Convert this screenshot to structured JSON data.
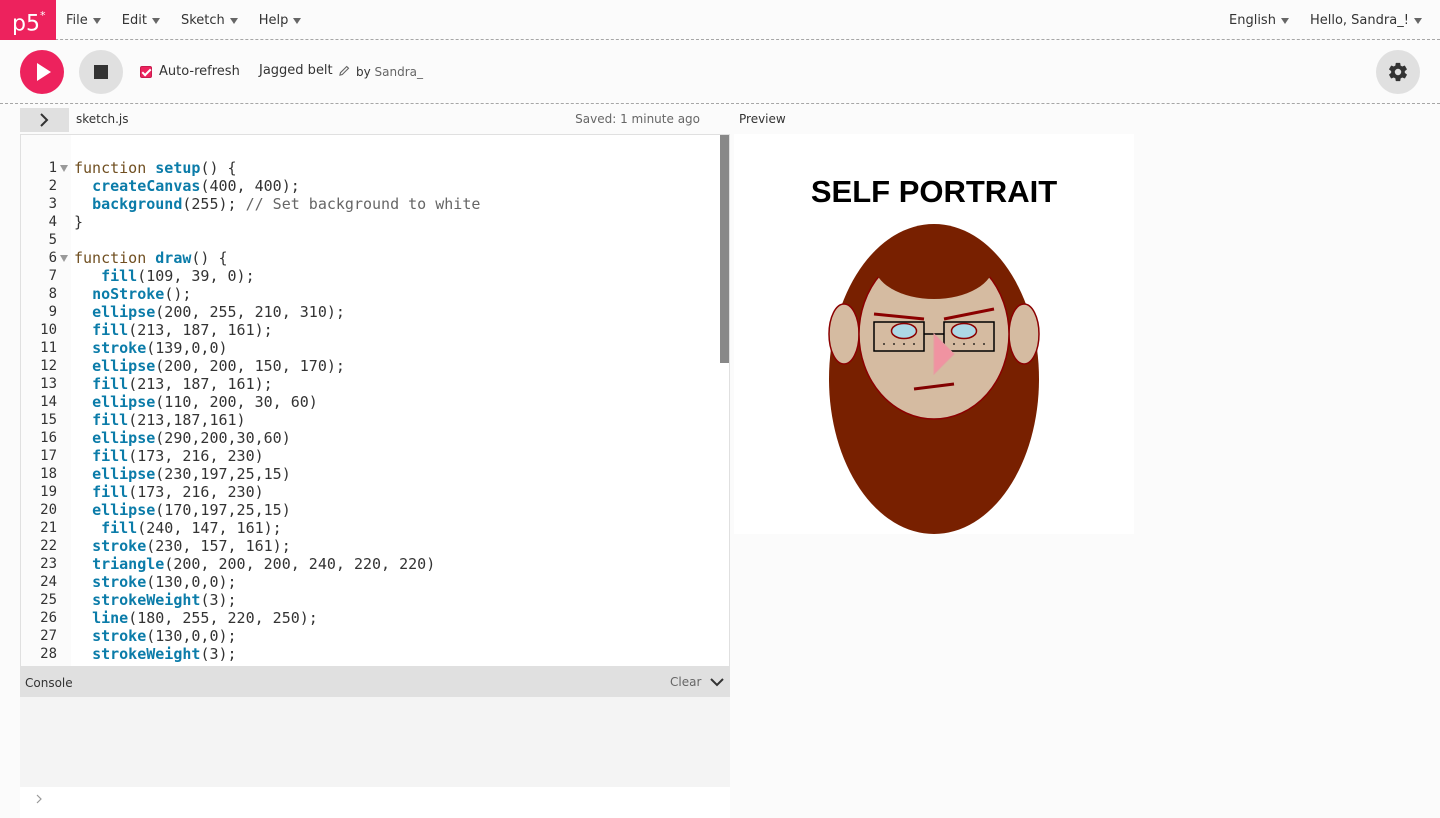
{
  "nav": {
    "logo": "p5",
    "logo_sup": "*",
    "menu": [
      "File",
      "Edit",
      "Sketch",
      "Help"
    ],
    "language": "English",
    "user_greeting": "Hello, Sandra_!"
  },
  "toolbar": {
    "auto_refresh_label": "Auto-refresh",
    "auto_refresh_checked": true,
    "sketch_name": "Jagged belt",
    "by_label": "by",
    "author": "Sandra_"
  },
  "editor": {
    "file_name": "sketch.js",
    "saved_status": "Saved: 1 minute ago",
    "preview_label": "Preview",
    "lines": [
      {
        "n": "1",
        "fold": true,
        "text": "function setup() {"
      },
      {
        "n": "2",
        "text": "  createCanvas(400, 400);"
      },
      {
        "n": "3",
        "text": "  background(255); // Set background to white"
      },
      {
        "n": "4",
        "text": "}"
      },
      {
        "n": "5",
        "text": ""
      },
      {
        "n": "6",
        "fold": true,
        "text": "function draw() {"
      },
      {
        "n": "7",
        "text": "   fill(109, 39, 0);"
      },
      {
        "n": "8",
        "text": "  noStroke();"
      },
      {
        "n": "9",
        "text": "  ellipse(200, 255, 210, 310);"
      },
      {
        "n": "10",
        "text": "  fill(213, 187, 161);"
      },
      {
        "n": "11",
        "text": "  stroke(139,0,0)"
      },
      {
        "n": "12",
        "text": "  ellipse(200, 200, 150, 170);"
      },
      {
        "n": "13",
        "text": "  fill(213, 187, 161);"
      },
      {
        "n": "14",
        "text": "  ellipse(110, 200, 30, 60)"
      },
      {
        "n": "15",
        "text": "  fill(213,187,161)"
      },
      {
        "n": "16",
        "text": "  ellipse(290,200,30,60)"
      },
      {
        "n": "17",
        "text": "  fill(173, 216, 230)"
      },
      {
        "n": "18",
        "text": "  ellipse(230,197,25,15)"
      },
      {
        "n": "19",
        "text": "  fill(173, 216, 230)"
      },
      {
        "n": "20",
        "text": "  ellipse(170,197,25,15)"
      },
      {
        "n": "21",
        "text": "   fill(240, 147, 161);"
      },
      {
        "n": "22",
        "text": "  stroke(230, 157, 161);"
      },
      {
        "n": "23",
        "text": "  triangle(200, 200, 200, 240, 220, 220)"
      },
      {
        "n": "24",
        "text": "  stroke(130,0,0);"
      },
      {
        "n": "25",
        "text": "  strokeWeight(3);"
      },
      {
        "n": "26",
        "text": "  line(180, 255, 220, 250);"
      },
      {
        "n": "27",
        "text": "  stroke(130,0,0);"
      },
      {
        "n": "28",
        "text": "  strokeWeight(3);"
      }
    ]
  },
  "console": {
    "title": "Console",
    "clear_label": "Clear"
  },
  "preview": {
    "canvas_title": "SELF PORTRAIT"
  },
  "colors": {
    "accent": "#ed225d",
    "hair": "#6d2700",
    "skin": "#d5bba1",
    "glasses_lens": "#add8e6",
    "nose": "#f093a1",
    "outline": "#8b0000"
  }
}
